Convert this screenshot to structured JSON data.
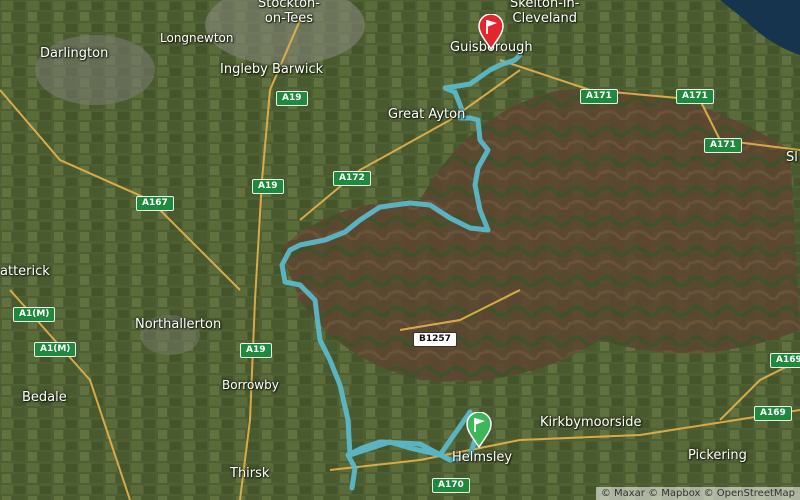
{
  "places": {
    "stockton": "Stockton-\non-Tees",
    "skelton": "Skelton-in-\nCleveland",
    "darlington": "Darlington",
    "longnewton": "Longnewton",
    "ingleby": "Ingleby Barwick",
    "guisborough": "Guisborough",
    "great_ayton": "Great Ayton",
    "catterick": "atterick",
    "northallerton": "Northallerton",
    "borrowby": "Borrowby",
    "bedale": "Bedale",
    "thirsk": "Thirsk",
    "helmsley": "Helmsley",
    "kirkbymoorside": "Kirkbymoorside",
    "pickering": "Pickering",
    "sl": "Sl"
  },
  "roads": {
    "a19_1": "A19",
    "a19_2": "A19",
    "a19_3": "A19",
    "a172": "A172",
    "a167": "A167",
    "a171_1": "A171",
    "a171_2": "A171",
    "a171_3": "A171",
    "a1m_1": "A1(M)",
    "a1m_2": "A1(M)",
    "b1257": "B1257",
    "a170": "A170",
    "a169_1": "A169",
    "a169_2": "A169"
  },
  "markers": {
    "start": "green-flag-icon",
    "finish": "red-flag-icon"
  },
  "attribution": "© Maxar © Mapbox © OpenStreetMap",
  "colors": {
    "route": "#5bb8c9",
    "start_pin": "#3cb85a",
    "finish_pin": "#e3262d",
    "road": "#e8b24a"
  }
}
